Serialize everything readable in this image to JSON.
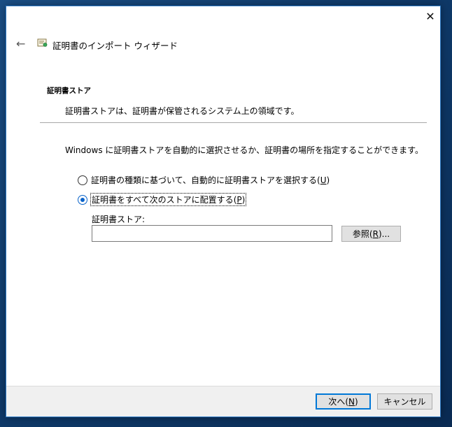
{
  "window": {
    "title": "証明書のインポート ウィザード",
    "close_glyph": "✕",
    "back_glyph": "←"
  },
  "page": {
    "heading": "証明書ストア",
    "description": "証明書ストアは、証明書が保管されるシステム上の領域です。",
    "instruction": "Windows に証明書ストアを自動的に選択させるか、証明書の場所を指定することができます。"
  },
  "options": [
    {
      "label": "証明書の種類に基づいて、自動的に証明書ストアを選択する",
      "accesskey": "U",
      "checked": false
    },
    {
      "label": "証明書をすべて次のストアに配置する",
      "accesskey": "P",
      "checked": true
    }
  ],
  "store": {
    "label": "証明書ストア:",
    "value": "",
    "browse_label": "参照",
    "browse_accesskey": "R",
    "browse_suffix": "..."
  },
  "footer": {
    "next_label": "次へ",
    "next_accesskey": "N",
    "cancel_label": "キャンセル"
  },
  "colors": {
    "accent": "#0078d7",
    "window_border": "#2b78c4",
    "desktop": "#0f3a6a"
  }
}
